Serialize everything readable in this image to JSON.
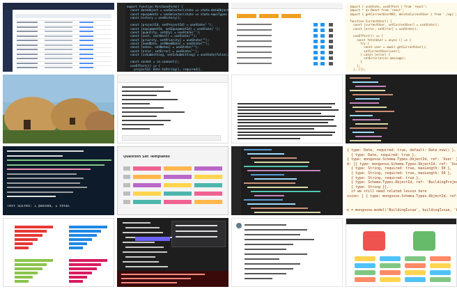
{
  "tiles": [
    {
      "id": "t1",
      "kind": "dark-dashboard-table"
    },
    {
      "id": "t2",
      "kind": "code-editor",
      "code": [
        "export function PurchaseForm() {",
        "  const dateObject = useSelector(state => state.dateObject);",
        "  const equipments = useSelector(state => state.equiTypes.tem",
        "  const history = useHistory();",
        "",
        "  const [projectId, setProjectId] = useState('');",
        "  const [equipmentId, setEquipmentId] = useState('');",
        "  const [quantity, setQty] = useState('');",
        "  const [cost, costUnit] = useState(\"\");",
        "  const [priority, setPriority] = useState(\"\");",
        "  const [needDate, setNeedDate] = useState(\"\");",
        "  const [notes, setNotes] = useState(\"\");",
        "  const [error, setError] = useState('');",
        "  const [isSubmitting, setIsSubmitting] = useState(false);",
        "",
        "  const socket = io.connect();",
        "  useEffect(() => {",
        "    projectId: Date.toString(), required(),"
      ]
    },
    {
      "id": "t3",
      "kind": "light-admin-list"
    },
    {
      "id": "t4",
      "kind": "light-code",
      "code": [
        "import { useState, useEffect } from 'react';",
        "import * as React from 'react';",
        "import { getCurrentUserMAI, deleteCurrentUser } from './api';",
        "",
        "function CurrentUser() {",
        "  const [currentUser, setCurrentUser] = useState();",
        "  const [error, setError] = useState();",
        "",
        "  useEffect(() => {",
        "    const fetchUser = async () => {",
        "      try {",
        "        const user = await getCurrentUser();",
        "        setCurrentUser(user);",
        "      } catch (error) {",
        "        setError(error.message);",
        "      }",
        "    };",
        "  }, []);"
      ]
    },
    {
      "id": "t5",
      "kind": "photo"
    },
    {
      "id": "t6",
      "kind": "jupyter"
    },
    {
      "id": "t7",
      "kind": "document"
    },
    {
      "id": "t8",
      "kind": "dark-code-narrow"
    },
    {
      "id": "t9",
      "kind": "terminal",
      "lines": [
        "Test Suites: 1 passed, 1 total"
      ]
    },
    {
      "id": "t10",
      "kind": "question-form",
      "title": "Question Set Templates"
    },
    {
      "id": "t11",
      "kind": "dark-code"
    },
    {
      "id": "t12",
      "kind": "schema-code",
      "code": [
        "{ type: Date, required: true, default: Date.now() },",
        "  { type: Date, required: true },",
        "{ type: mongoose.Schema.Types.ObjectId, ref: 'User' },",
        "d: [{ type: mongoose.Schema.Types.ObjectId, ref: 'User' }]",
        "  { type: String, required: true, maxLength: 50 },",
        "  { type: String, required: true, maxLength: 50 },",
        "  { type: String, required: true },",
        "  { type: Schema.Types.ObjectId, ref: 'BuildingProject' },",
        "  { type: String }],",
        "  if we still need related lesson here",
        "ssion: [ { type: mongoose.Schema.Types.ObjectId, ref: 'Build",
        "",
        "",
        "e = mongoose.model('BuildingIssue', buildingIssue, 'build"
      ]
    },
    {
      "id": "t13",
      "kind": "bar-charts"
    },
    {
      "id": "t14",
      "kind": "dark-explorer"
    },
    {
      "id": "t15",
      "kind": "email-thread"
    },
    {
      "id": "t16",
      "kind": "app-screen"
    }
  ]
}
